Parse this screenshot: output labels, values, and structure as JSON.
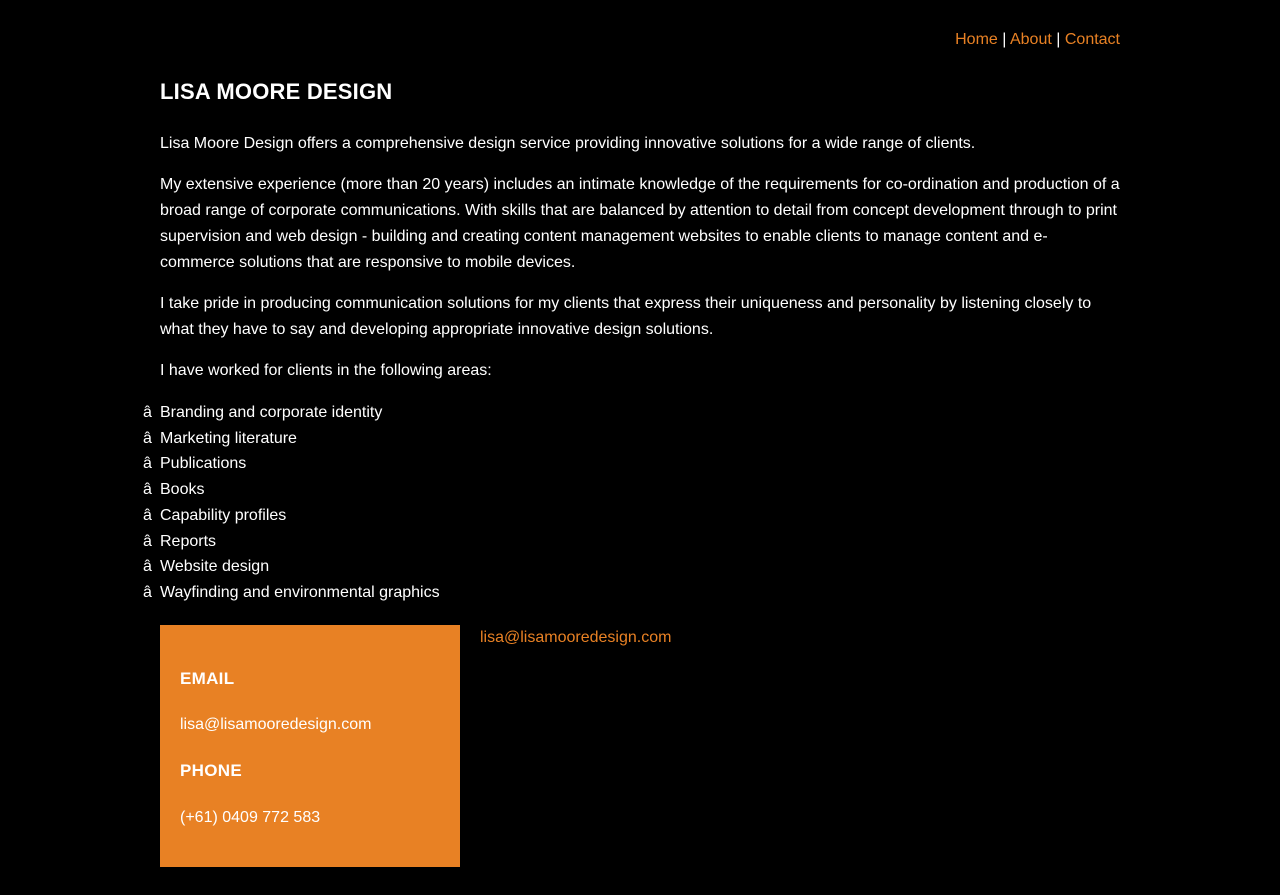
{
  "nav": {
    "home": "Home",
    "about": "About",
    "contact": "Contact",
    "separator": "|"
  },
  "header": {
    "title": "LISA MOORE DESIGN"
  },
  "intro": {
    "paragraphs": [
      "Lisa Moore Design offers a comprehensive design service providing innovative solutions for a wide range of clients.",
      "My extensive experience (more than 20 years) includes an intimate knowledge of the requirements for co-ordination and production of a broad range of corporate communications. With skills that are balanced by attention to detail from concept development through to print supervision and web design - building and creating content management websites to enable clients to manage content and e-commerce solutions that are responsive to mobile devices.",
      "I take pride in producing communication solutions for my clients that express their uniqueness and personality by listening closely to what they have to say and developing appropriate innovative design solutions.",
      "I have worked for clients in the following areas:"
    ]
  },
  "areas": {
    "bullet": "â",
    "items": [
      "Branding and corporate identity",
      "Marketing literature",
      "Publications",
      "Books",
      "Capability profiles",
      "Reports",
      "Website design",
      "Wayfinding and environmental graphics"
    ]
  },
  "contact": {
    "email_heading": "EMAIL",
    "email_value": "lisa@lisamooredesign.com",
    "phone_heading": "PHONE",
    "phone_value": "(+61) 0409 772 583",
    "side_email_link": "lisa@lisamooredesign.com"
  },
  "colors": {
    "background": "#000000",
    "accent": "#e88124",
    "text": "#ffffff"
  }
}
